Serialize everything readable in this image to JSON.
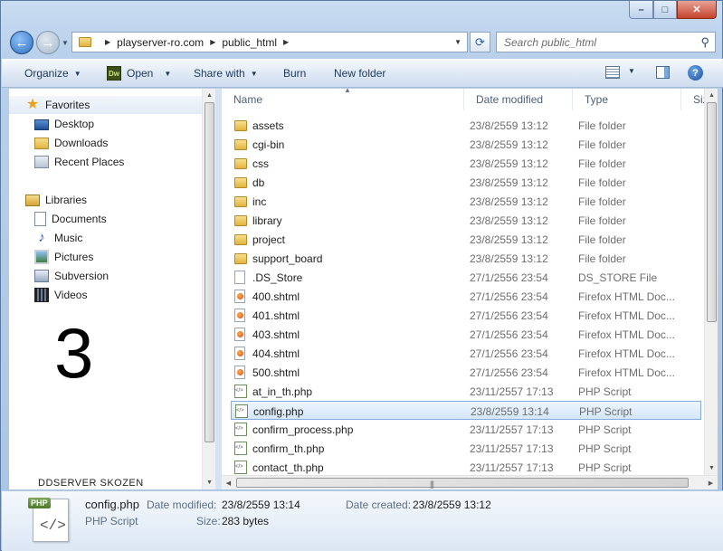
{
  "window": {
    "caption_minimize": "–",
    "caption_maximize": "□",
    "caption_close": "✕"
  },
  "address": {
    "crumbs": [
      "playserver-ro.com",
      "public_html"
    ],
    "search_placeholder": "Search public_html"
  },
  "toolbar": {
    "organize": "Organize",
    "open": "Open",
    "dw_badge": "Dw",
    "share_with": "Share with",
    "burn": "Burn",
    "new_folder": "New folder",
    "help": "?"
  },
  "navpane": {
    "favorites": "Favorites",
    "favorites_items": [
      "Desktop",
      "Downloads",
      "Recent Places"
    ],
    "libraries": "Libraries",
    "library_items": [
      "Documents",
      "Music",
      "Pictures",
      "Subversion",
      "Videos"
    ],
    "overlay_number": "3",
    "cut_off_item": "DDSERVER SKOZEN"
  },
  "columns": {
    "name": "Name",
    "date": "Date modified",
    "type": "Type",
    "size": "Size"
  },
  "files": [
    {
      "name": "assets",
      "date": "23/8/2559 13:12",
      "type": "File folder",
      "icon": "folder"
    },
    {
      "name": "cgi-bin",
      "date": "23/8/2559 13:12",
      "type": "File folder",
      "icon": "folder"
    },
    {
      "name": "css",
      "date": "23/8/2559 13:12",
      "type": "File folder",
      "icon": "folder"
    },
    {
      "name": "db",
      "date": "23/8/2559 13:12",
      "type": "File folder",
      "icon": "folder"
    },
    {
      "name": "inc",
      "date": "23/8/2559 13:12",
      "type": "File folder",
      "icon": "folder"
    },
    {
      "name": "library",
      "date": "23/8/2559 13:12",
      "type": "File folder",
      "icon": "folder"
    },
    {
      "name": "project",
      "date": "23/8/2559 13:12",
      "type": "File folder",
      "icon": "folder"
    },
    {
      "name": "support_board",
      "date": "23/8/2559 13:12",
      "type": "File folder",
      "icon": "folder"
    },
    {
      "name": ".DS_Store",
      "date": "27/1/2556 23:54",
      "type": "DS_STORE File",
      "icon": "file"
    },
    {
      "name": "400.shtml",
      "date": "27/1/2556 23:54",
      "type": "Firefox HTML Doc...",
      "icon": "html"
    },
    {
      "name": "401.shtml",
      "date": "27/1/2556 23:54",
      "type": "Firefox HTML Doc...",
      "icon": "html"
    },
    {
      "name": "403.shtml",
      "date": "27/1/2556 23:54",
      "type": "Firefox HTML Doc...",
      "icon": "html"
    },
    {
      "name": "404.shtml",
      "date": "27/1/2556 23:54",
      "type": "Firefox HTML Doc...",
      "icon": "html"
    },
    {
      "name": "500.shtml",
      "date": "27/1/2556 23:54",
      "type": "Firefox HTML Doc...",
      "icon": "html"
    },
    {
      "name": "at_in_th.php",
      "date": "23/11/2557 17:13",
      "type": "PHP Script",
      "icon": "php"
    },
    {
      "name": "config.php",
      "date": "23/8/2559 13:14",
      "type": "PHP Script",
      "icon": "php",
      "selected": true
    },
    {
      "name": "confirm_process.php",
      "date": "23/11/2557 17:13",
      "type": "PHP Script",
      "icon": "php"
    },
    {
      "name": "confirm_th.php",
      "date": "23/11/2557 17:13",
      "type": "PHP Script",
      "icon": "php"
    },
    {
      "name": "contact_th.php",
      "date": "23/11/2557 17:13",
      "type": "PHP Script",
      "icon": "php"
    }
  ],
  "details": {
    "badge": "PHP",
    "code_glyph": "</>",
    "filename": "config.php",
    "filetype": "PHP Script",
    "date_modified_label": "Date modified:",
    "date_modified": "23/8/2559 13:14",
    "size_label": "Size:",
    "size": "283 bytes",
    "date_created_label": "Date created:",
    "date_created": "23/8/2559 13:12"
  }
}
